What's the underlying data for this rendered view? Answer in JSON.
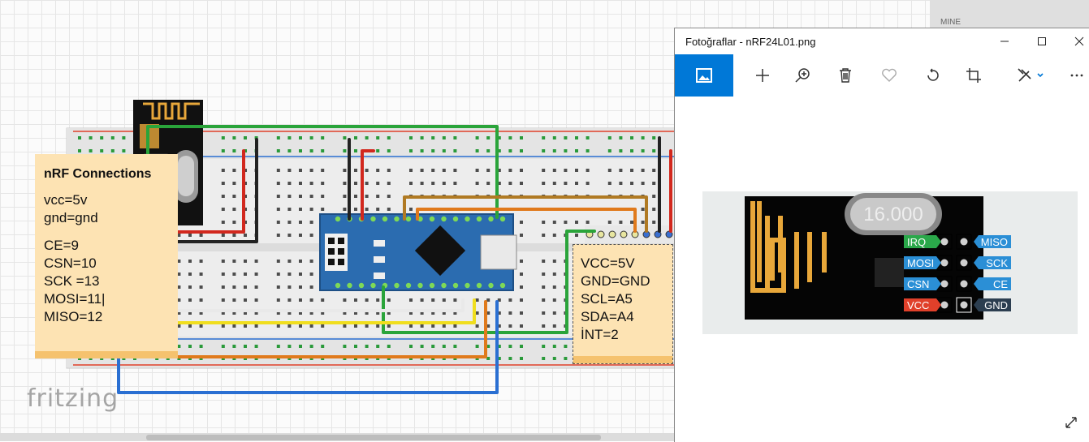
{
  "fritzing": {
    "logo": "fritzing",
    "note_left": {
      "title": "nRF Connections",
      "lines": [
        "vcc=5v",
        "gnd=gnd",
        "",
        "CE=9",
        "CSN=10",
        "SCK =13",
        "MOSI=11|",
        "MISO=12"
      ]
    },
    "note_right": {
      "lines": [
        "VCC=5V",
        "GND=GND",
        "SCL=A5",
        "SDA=A4",
        "İNT=2"
      ]
    },
    "parts_bin_label": "MINE",
    "wire_colors": {
      "green": "#2aa43a",
      "red": "#d2281e",
      "black": "#222222",
      "orange": "#e07a1c",
      "brown": "#b07a23",
      "yellow": "#f0de1e",
      "blue": "#2a6fd2",
      "arduino_blue": "#2b6cb0"
    }
  },
  "photos_window": {
    "title": "Fotoğraflar - nRF24L01.png",
    "accent": "#0078d7",
    "toolbar": [
      "view-image-icon",
      "add-icon",
      "zoom-icon",
      "delete-icon",
      "favorite-icon",
      "rotate-icon",
      "crop-icon",
      "edit-icon",
      "more-icon"
    ],
    "image": {
      "crystal": "16.000",
      "pins_left": [
        "IRQ",
        "MOSI",
        "CSN",
        "VCC"
      ],
      "pins_right": [
        "MISO",
        "SCK",
        "CE",
        "GND"
      ],
      "pin_colors": {
        "IRQ": "#2aa84a",
        "MOSI": "#2b8fd6",
        "CSN": "#2b8fd6",
        "VCC": "#e0402a",
        "MISO": "#2b8fd6",
        "SCK": "#2b8fd6",
        "CE": "#2b8fd6",
        "GND": "#2c3e50"
      }
    }
  }
}
